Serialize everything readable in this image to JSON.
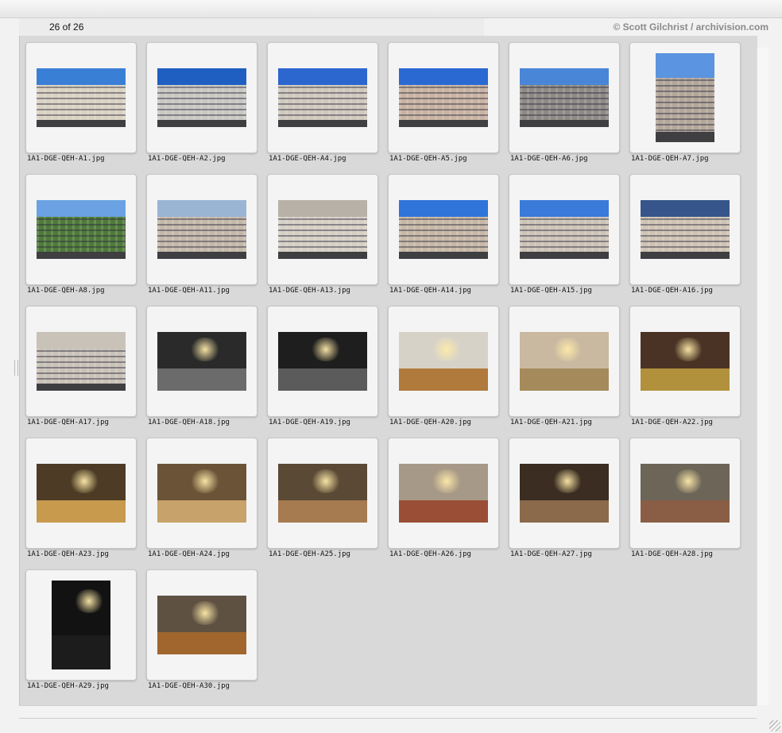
{
  "window": {
    "count_label": "26 of 26",
    "credit": "© Scott Gilchrist / archivision.com"
  },
  "thumbnails": [
    {
      "filename": "1A1-DGE-QEH-A1.jpg",
      "scene": "exterior",
      "orientation": "landscape",
      "sky": "#3a7fd6",
      "body": "#d9d2c3"
    },
    {
      "filename": "1A1-DGE-QEH-A2.jpg",
      "scene": "exterior",
      "orientation": "landscape",
      "sky": "#1f5fc2",
      "body": "#c9c7c2"
    },
    {
      "filename": "1A1-DGE-QEH-A4.jpg",
      "scene": "exterior",
      "orientation": "landscape",
      "sky": "#2c66cf",
      "body": "#cfc8bd"
    },
    {
      "filename": "1A1-DGE-QEH-A5.jpg",
      "scene": "exterior",
      "orientation": "landscape",
      "sky": "#2a69d2",
      "body": "#c8b3a2"
    },
    {
      "filename": "1A1-DGE-QEH-A6.jpg",
      "scene": "exterior",
      "orientation": "landscape",
      "sky": "#4a86d8",
      "body": "#8e8a86"
    },
    {
      "filename": "1A1-DGE-QEH-A7.jpg",
      "scene": "exterior",
      "orientation": "portrait",
      "sky": "#5b94e0",
      "body": "#b3a79a"
    },
    {
      "filename": "1A1-DGE-QEH-A8.jpg",
      "scene": "exterior",
      "orientation": "landscape",
      "sky": "#6aa2e4",
      "body": "#4f7a3a"
    },
    {
      "filename": "1A1-DGE-QEH-A11.jpg",
      "scene": "exterior",
      "orientation": "landscape",
      "sky": "#9ab4d4",
      "body": "#c4b8aa"
    },
    {
      "filename": "1A1-DGE-QEH-A13.jpg",
      "scene": "exterior",
      "orientation": "landscape",
      "sky": "#b7b1a8",
      "body": "#d6cfc4"
    },
    {
      "filename": "1A1-DGE-QEH-A14.jpg",
      "scene": "exterior",
      "orientation": "landscape",
      "sky": "#2f74d8",
      "body": "#c7b8a6"
    },
    {
      "filename": "1A1-DGE-QEH-A15.jpg",
      "scene": "exterior",
      "orientation": "landscape",
      "sky": "#3a7ad9",
      "body": "#cdc3b7"
    },
    {
      "filename": "1A1-DGE-QEH-A16.jpg",
      "scene": "exterior",
      "orientation": "landscape",
      "sky": "#36558a",
      "body": "#cfc3b4"
    },
    {
      "filename": "1A1-DGE-QEH-A17.jpg",
      "scene": "exterior",
      "orientation": "landscape",
      "sky": "#c9c2b8",
      "body": "#c9c2b8"
    },
    {
      "filename": "1A1-DGE-QEH-A18.jpg",
      "scene": "interior",
      "orientation": "landscape",
      "sky": "#2a2a2a",
      "body": "#6b6b6b"
    },
    {
      "filename": "1A1-DGE-QEH-A19.jpg",
      "scene": "interior",
      "orientation": "landscape",
      "sky": "#1e1e1e",
      "body": "#5b5b5b"
    },
    {
      "filename": "1A1-DGE-QEH-A20.jpg",
      "scene": "interior",
      "orientation": "landscape",
      "sky": "#d7d2c8",
      "body": "#b07a3c"
    },
    {
      "filename": "1A1-DGE-QEH-A21.jpg",
      "scene": "interior",
      "orientation": "landscape",
      "sky": "#c9b9a1",
      "body": "#a58a5b"
    },
    {
      "filename": "1A1-DGE-QEH-A22.jpg",
      "scene": "interior",
      "orientation": "landscape",
      "sky": "#4a3324",
      "body": "#b2913d"
    },
    {
      "filename": "1A1-DGE-QEH-A23.jpg",
      "scene": "interior",
      "orientation": "landscape",
      "sky": "#4d3b25",
      "body": "#c79a4e"
    },
    {
      "filename": "1A1-DGE-QEH-A24.jpg",
      "scene": "interior",
      "orientation": "landscape",
      "sky": "#6a5337",
      "body": "#c7a26a"
    },
    {
      "filename": "1A1-DGE-QEH-A25.jpg",
      "scene": "interior",
      "orientation": "landscape",
      "sky": "#5a4934",
      "body": "#a57b4f"
    },
    {
      "filename": "1A1-DGE-QEH-A26.jpg",
      "scene": "interior",
      "orientation": "landscape",
      "sky": "#a79987",
      "body": "#9a4e35"
    },
    {
      "filename": "1A1-DGE-QEH-A27.jpg",
      "scene": "interior",
      "orientation": "landscape",
      "sky": "#3b2d22",
      "body": "#8a6a4a"
    },
    {
      "filename": "1A1-DGE-QEH-A28.jpg",
      "scene": "interior",
      "orientation": "landscape",
      "sky": "#6c6558",
      "body": "#8a5e45"
    },
    {
      "filename": "1A1-DGE-QEH-A29.jpg",
      "scene": "interior",
      "orientation": "portrait",
      "sky": "#121212",
      "body": "#1c1c1c"
    },
    {
      "filename": "1A1-DGE-QEH-A30.jpg",
      "scene": "interior",
      "orientation": "landscape",
      "sky": "#5e5142",
      "body": "#a0662e"
    }
  ]
}
